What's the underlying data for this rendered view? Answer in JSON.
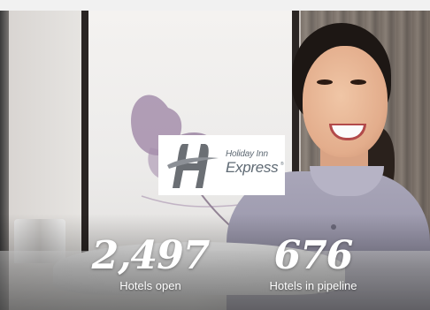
{
  "brand": {
    "name_line1": "Holiday Inn",
    "name_line2": "Express",
    "registered_mark": "®",
    "logo_mark_color": "#6b6f74"
  },
  "stats": [
    {
      "value": "2,497",
      "label": "Hotels open"
    },
    {
      "value": "676",
      "label": "Hotels in pipeline"
    }
  ],
  "colors": {
    "stat_text": "#ffffff",
    "logo_text": "#5f6a74",
    "uniform": "#a9a6b9"
  }
}
